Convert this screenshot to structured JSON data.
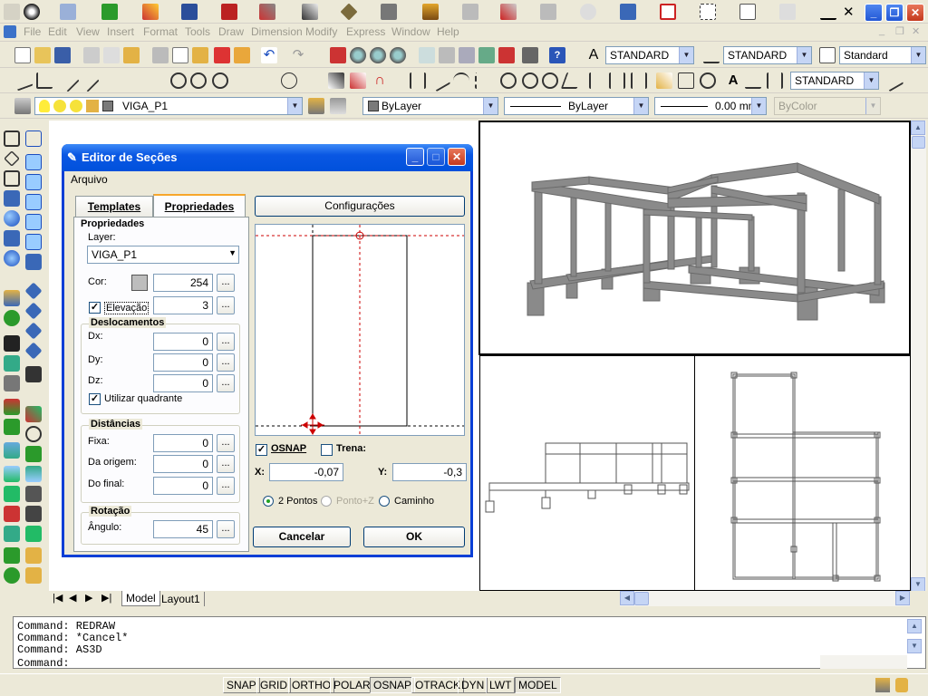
{
  "app": {
    "menu": [
      "File",
      "Edit",
      "View",
      "Insert",
      "Format",
      "Tools",
      "Draw",
      "Dimension",
      "Modify",
      "Express",
      "Window",
      "Help"
    ]
  },
  "toolbar": {
    "text_style": "STANDARD",
    "dim_style": "STANDARD",
    "table_style": "Standard",
    "ml_style": "STANDARD"
  },
  "layers": {
    "layer": "VIGA_P1",
    "color": "ByLayer",
    "linetype": "ByLayer",
    "lineweight": "0.00 mm",
    "plotstyle": "ByColor"
  },
  "dialog": {
    "title": "Editor de Seções",
    "menu": "Arquivo",
    "tab_templates": "Templates",
    "tab_props": "Propriedades",
    "config": "Configurações",
    "group_props": "Propriedades",
    "layer_label": "Layer:",
    "layer_value": "VIGA_P1",
    "color_label": "Cor:",
    "color_value": "254",
    "elev_label": "Elevação",
    "elev_value": "3",
    "group_disp": "Deslocamentos",
    "dx_label": "Dx:",
    "dx": "0",
    "dy_label": "Dy:",
    "dy": "0",
    "dz_label": "Dz:",
    "dz": "0",
    "quad_label": "Utilizar quadrante",
    "group_dist": "Distâncias",
    "fixa_label": "Fixa:",
    "fixa": "0",
    "origem_label": "Da origem:",
    "origem": "0",
    "final_label": "Do final:",
    "final": "0",
    "group_rot": "Rotação",
    "angle_label": "Ângulo:",
    "angle": "45",
    "osnap": "OSNAP",
    "trena": "Trena:",
    "x_label": "X:",
    "x": "-0,07",
    "y_label": "Y:",
    "y": "-0,3",
    "opt1": "2 Pontos",
    "opt2": "Ponto+Z",
    "opt3": "Caminho",
    "cancel": "Cancelar",
    "ok": "OK",
    "dots": "..."
  },
  "tabs": {
    "model": "Model",
    "layout1": "Layout1"
  },
  "commands": [
    "Command:  REDRAW",
    "Command: *Cancel*",
    "Command: AS3D",
    "Command:"
  ],
  "status": [
    "SNAP",
    "GRID",
    "ORTHO",
    "POLAR",
    "OSNAP",
    "OTRACK",
    "DYN",
    "LWT",
    "MODEL"
  ],
  "colors": {
    "title_bar": "#0a57e3",
    "toolbar": "#ece9d8",
    "beam": "#8a8a8a"
  }
}
